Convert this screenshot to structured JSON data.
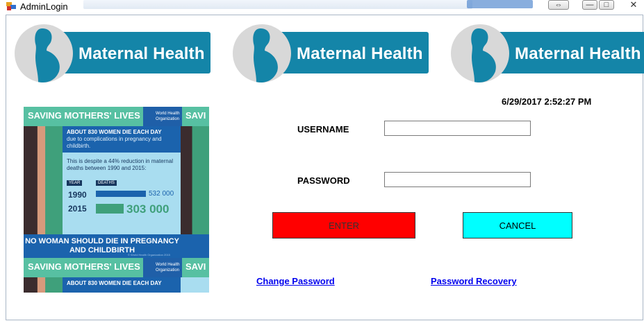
{
  "window": {
    "title": "AdminLogin",
    "controls": {
      "resize": "⇔",
      "minimize": "—",
      "maximize": "□",
      "close": "✕"
    }
  },
  "banners": [
    {
      "label": "Maternal Health"
    },
    {
      "label": "Maternal Health"
    },
    {
      "label": "Maternal Health"
    }
  ],
  "infographic": {
    "header": "SAVING MOTHERS' LIVES",
    "header_partial": "SAVI",
    "org": "World Health Organization",
    "headline": "ABOUT 830 WOMEN DIE EACH DAY",
    "subline": "due to complications in pregnancy and childbirth.",
    "despite": "This is despite a 44% reduction in maternal deaths between 1990 and 2015:",
    "col_year": "YEAR",
    "col_deaths": "DEATHS",
    "year1": "1990",
    "deaths1": "532 000",
    "year2": "2015",
    "deaths2": "303 000",
    "footer": "NO WOMAN SHOULD DIE IN PREGNANCY AND CHILDBIRTH",
    "credit": "© World Health Organization 2015",
    "colors": {
      "green": "#57c0a2",
      "blue": "#1b63ad",
      "light": "#a9ddf0"
    }
  },
  "form": {
    "datetime": "6/29/2017 2:52:27 PM",
    "username_label": "USERNAME",
    "username_value": "",
    "password_label": "PASSWORD",
    "password_value": "",
    "enter_label": "ENTER",
    "cancel_label": "CANCEL",
    "change_password_link": "Change Password",
    "password_recovery_link": "Password Recovery",
    "colors": {
      "enter": "#ff0000",
      "cancel": "#00ffff",
      "link": "#0000ee"
    }
  }
}
